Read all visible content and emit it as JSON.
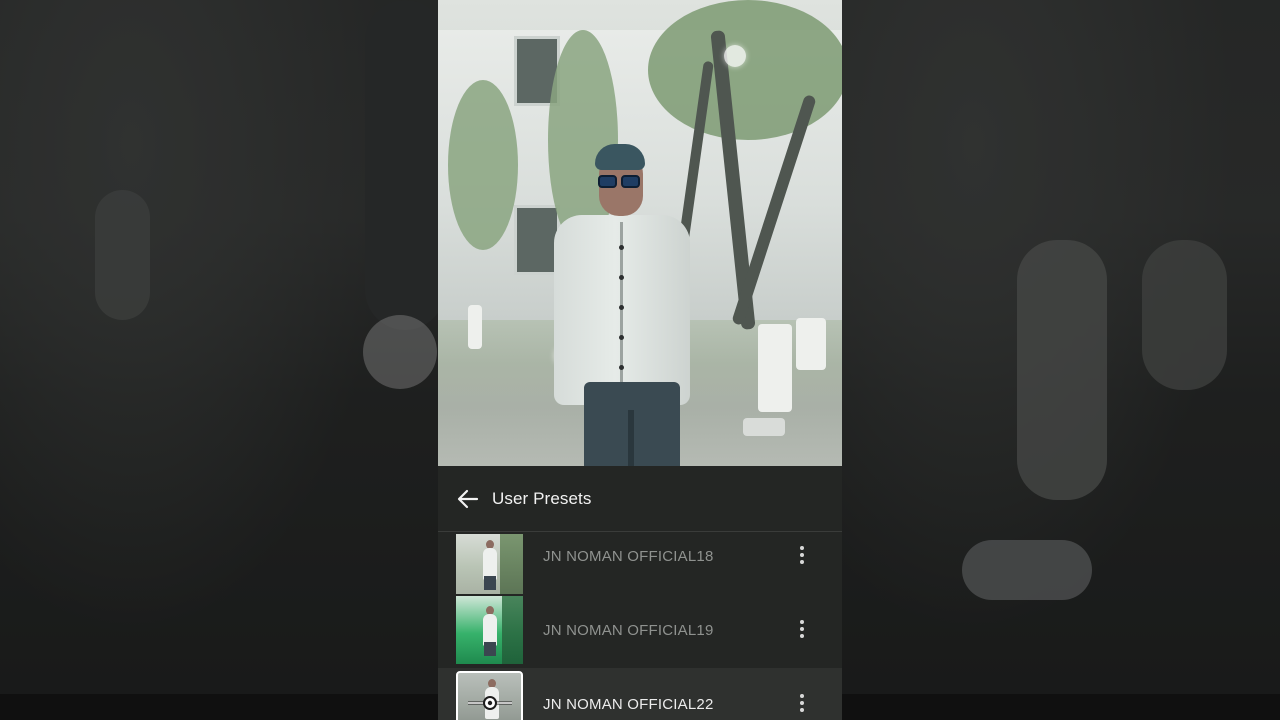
{
  "panel": {
    "title": "User Presets",
    "back_icon": "arrow-left-icon"
  },
  "presets": [
    {
      "name": "JN NOMAN OFFICIAL18",
      "selected": false,
      "menu_icon": "more-vertical-icon"
    },
    {
      "name": "JN NOMAN OFFICIAL19",
      "selected": false,
      "menu_icon": "more-vertical-icon"
    },
    {
      "name": "JN NOMAN OFFICIAL22",
      "selected": true,
      "menu_icon": "more-vertical-icon"
    }
  ],
  "colors": {
    "panel_bg": "#242624",
    "selected_row_bg": "#2f312f",
    "title_text": "#f2f2f2",
    "inactive_text": "#8f928f",
    "active_text": "#ececec"
  }
}
